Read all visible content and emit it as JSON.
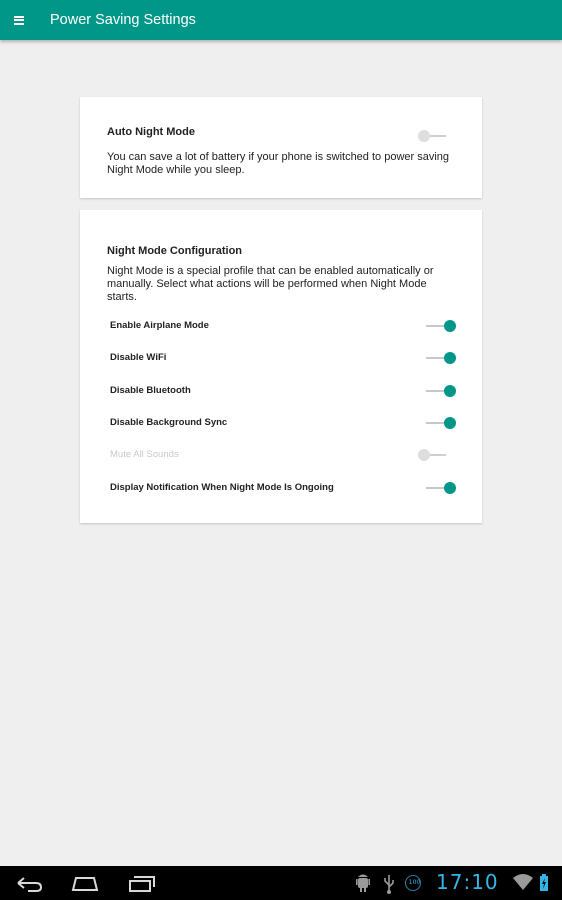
{
  "appbar": {
    "title": "Power Saving Settings"
  },
  "auto_night": {
    "title": "Auto Night Mode",
    "description": "You can save a lot of battery if your phone is switched to power saving Night Mode while you sleep.",
    "enabled": false
  },
  "night_config": {
    "title": "Night Mode Configuration",
    "description": "Night Mode is a special profile that can be enabled automatically or manually. Select what actions will be performed when Night Mode starts.",
    "options": [
      {
        "label": "Enable Airplane Mode",
        "on": true,
        "disabled": false
      },
      {
        "label": "Disable WiFi",
        "on": true,
        "disabled": false
      },
      {
        "label": "Disable Bluetooth",
        "on": true,
        "disabled": false
      },
      {
        "label": "Disable Background Sync",
        "on": true,
        "disabled": false
      },
      {
        "label": "Mute All Sounds",
        "on": false,
        "disabled": true
      },
      {
        "label": "Display Notification When Night Mode Is Ongoing",
        "on": true,
        "disabled": false
      }
    ]
  },
  "status_bar": {
    "time": "17:10",
    "battery_badge": "100",
    "icons": [
      "android-debug-icon",
      "usb-icon",
      "battery-100-icon",
      "wifi-icon",
      "battery-icon"
    ]
  },
  "nav_bar": {
    "buttons": [
      "back-icon",
      "home-icon",
      "recents-icon"
    ]
  },
  "colors": {
    "accent": "#009688",
    "clock": "#33b5e5",
    "background": "#efefef"
  }
}
